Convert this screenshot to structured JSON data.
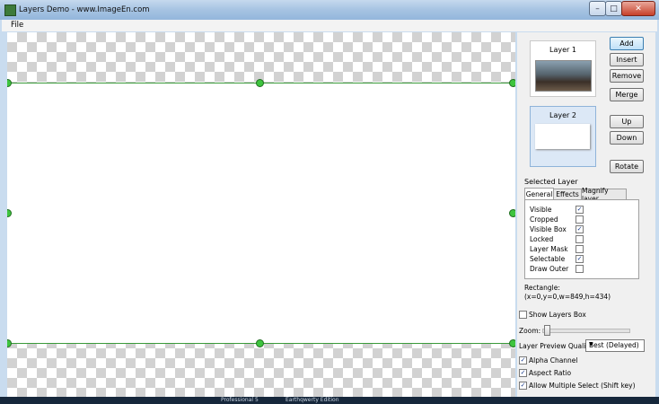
{
  "window": {
    "title": "Layers Demo - www.ImageEn.com"
  },
  "menu": {
    "file": "File"
  },
  "layers": [
    {
      "name": "Layer 1",
      "selected": false
    },
    {
      "name": "Layer 2",
      "selected": true
    }
  ],
  "buttons": {
    "add": "Add",
    "insert": "Insert",
    "remove": "Remove",
    "merge": "Merge",
    "up": "Up",
    "down": "Down",
    "rotate": "Rotate"
  },
  "selected_layer": {
    "label": "Selected Layer",
    "tabs": [
      "General",
      "Effects",
      "Magnify layer"
    ],
    "active_tab": "General",
    "properties": [
      {
        "label": "Visible",
        "checked": true
      },
      {
        "label": "Cropped",
        "checked": false
      },
      {
        "label": "Visible Box",
        "checked": true
      },
      {
        "label": "Locked",
        "checked": false
      },
      {
        "label": "Layer Mask",
        "checked": false
      },
      {
        "label": "Selectable",
        "checked": true
      },
      {
        "label": "Draw Outer",
        "checked": false
      }
    ]
  },
  "rectangle": {
    "label": "Rectangle:",
    "value": "(x=0,y=0,w=849,h=434)"
  },
  "show_layers_box": {
    "label": "Show Layers Box",
    "checked": false
  },
  "zoom": {
    "label": "Zoom:",
    "level": 0
  },
  "preview_quality": {
    "label": "Layer Preview Quality:",
    "value": "Best (Delayed)"
  },
  "options": [
    {
      "label": "Alpha Channel",
      "checked": true
    },
    {
      "label": "Aspect Ratio",
      "checked": true
    },
    {
      "label": "Allow Multiple Select (Shift key)",
      "checked": true
    }
  ],
  "taskbar": {
    "item1": "Professional 5",
    "item2": "Earthqwerty Edition"
  },
  "colors": {
    "selection_line": "#3a9a3a",
    "handle": "#3ec43e",
    "selected_layer_bg": "#dce8f6"
  }
}
